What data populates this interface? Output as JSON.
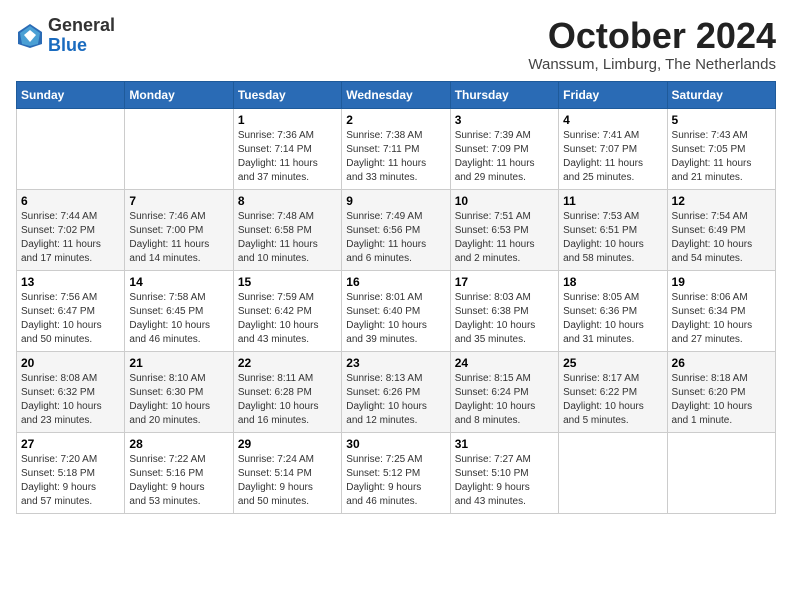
{
  "header": {
    "logo": {
      "general": "General",
      "blue": "Blue"
    },
    "title": "October 2024",
    "location": "Wanssum, Limburg, The Netherlands"
  },
  "calendar": {
    "weekdays": [
      "Sunday",
      "Monday",
      "Tuesday",
      "Wednesday",
      "Thursday",
      "Friday",
      "Saturday"
    ],
    "weeks": [
      [
        {
          "day": "",
          "info": ""
        },
        {
          "day": "",
          "info": ""
        },
        {
          "day": "1",
          "info": "Sunrise: 7:36 AM\nSunset: 7:14 PM\nDaylight: 11 hours\nand 37 minutes."
        },
        {
          "day": "2",
          "info": "Sunrise: 7:38 AM\nSunset: 7:11 PM\nDaylight: 11 hours\nand 33 minutes."
        },
        {
          "day": "3",
          "info": "Sunrise: 7:39 AM\nSunset: 7:09 PM\nDaylight: 11 hours\nand 29 minutes."
        },
        {
          "day": "4",
          "info": "Sunrise: 7:41 AM\nSunset: 7:07 PM\nDaylight: 11 hours\nand 25 minutes."
        },
        {
          "day": "5",
          "info": "Sunrise: 7:43 AM\nSunset: 7:05 PM\nDaylight: 11 hours\nand 21 minutes."
        }
      ],
      [
        {
          "day": "6",
          "info": "Sunrise: 7:44 AM\nSunset: 7:02 PM\nDaylight: 11 hours\nand 17 minutes."
        },
        {
          "day": "7",
          "info": "Sunrise: 7:46 AM\nSunset: 7:00 PM\nDaylight: 11 hours\nand 14 minutes."
        },
        {
          "day": "8",
          "info": "Sunrise: 7:48 AM\nSunset: 6:58 PM\nDaylight: 11 hours\nand 10 minutes."
        },
        {
          "day": "9",
          "info": "Sunrise: 7:49 AM\nSunset: 6:56 PM\nDaylight: 11 hours\nand 6 minutes."
        },
        {
          "day": "10",
          "info": "Sunrise: 7:51 AM\nSunset: 6:53 PM\nDaylight: 11 hours\nand 2 minutes."
        },
        {
          "day": "11",
          "info": "Sunrise: 7:53 AM\nSunset: 6:51 PM\nDaylight: 10 hours\nand 58 minutes."
        },
        {
          "day": "12",
          "info": "Sunrise: 7:54 AM\nSunset: 6:49 PM\nDaylight: 10 hours\nand 54 minutes."
        }
      ],
      [
        {
          "day": "13",
          "info": "Sunrise: 7:56 AM\nSunset: 6:47 PM\nDaylight: 10 hours\nand 50 minutes."
        },
        {
          "day": "14",
          "info": "Sunrise: 7:58 AM\nSunset: 6:45 PM\nDaylight: 10 hours\nand 46 minutes."
        },
        {
          "day": "15",
          "info": "Sunrise: 7:59 AM\nSunset: 6:42 PM\nDaylight: 10 hours\nand 43 minutes."
        },
        {
          "day": "16",
          "info": "Sunrise: 8:01 AM\nSunset: 6:40 PM\nDaylight: 10 hours\nand 39 minutes."
        },
        {
          "day": "17",
          "info": "Sunrise: 8:03 AM\nSunset: 6:38 PM\nDaylight: 10 hours\nand 35 minutes."
        },
        {
          "day": "18",
          "info": "Sunrise: 8:05 AM\nSunset: 6:36 PM\nDaylight: 10 hours\nand 31 minutes."
        },
        {
          "day": "19",
          "info": "Sunrise: 8:06 AM\nSunset: 6:34 PM\nDaylight: 10 hours\nand 27 minutes."
        }
      ],
      [
        {
          "day": "20",
          "info": "Sunrise: 8:08 AM\nSunset: 6:32 PM\nDaylight: 10 hours\nand 23 minutes."
        },
        {
          "day": "21",
          "info": "Sunrise: 8:10 AM\nSunset: 6:30 PM\nDaylight: 10 hours\nand 20 minutes."
        },
        {
          "day": "22",
          "info": "Sunrise: 8:11 AM\nSunset: 6:28 PM\nDaylight: 10 hours\nand 16 minutes."
        },
        {
          "day": "23",
          "info": "Sunrise: 8:13 AM\nSunset: 6:26 PM\nDaylight: 10 hours\nand 12 minutes."
        },
        {
          "day": "24",
          "info": "Sunrise: 8:15 AM\nSunset: 6:24 PM\nDaylight: 10 hours\nand 8 minutes."
        },
        {
          "day": "25",
          "info": "Sunrise: 8:17 AM\nSunset: 6:22 PM\nDaylight: 10 hours\nand 5 minutes."
        },
        {
          "day": "26",
          "info": "Sunrise: 8:18 AM\nSunset: 6:20 PM\nDaylight: 10 hours\nand 1 minute."
        }
      ],
      [
        {
          "day": "27",
          "info": "Sunrise: 7:20 AM\nSunset: 5:18 PM\nDaylight: 9 hours\nand 57 minutes."
        },
        {
          "day": "28",
          "info": "Sunrise: 7:22 AM\nSunset: 5:16 PM\nDaylight: 9 hours\nand 53 minutes."
        },
        {
          "day": "29",
          "info": "Sunrise: 7:24 AM\nSunset: 5:14 PM\nDaylight: 9 hours\nand 50 minutes."
        },
        {
          "day": "30",
          "info": "Sunrise: 7:25 AM\nSunset: 5:12 PM\nDaylight: 9 hours\nand 46 minutes."
        },
        {
          "day": "31",
          "info": "Sunrise: 7:27 AM\nSunset: 5:10 PM\nDaylight: 9 hours\nand 43 minutes."
        },
        {
          "day": "",
          "info": ""
        },
        {
          "day": "",
          "info": ""
        }
      ]
    ]
  }
}
